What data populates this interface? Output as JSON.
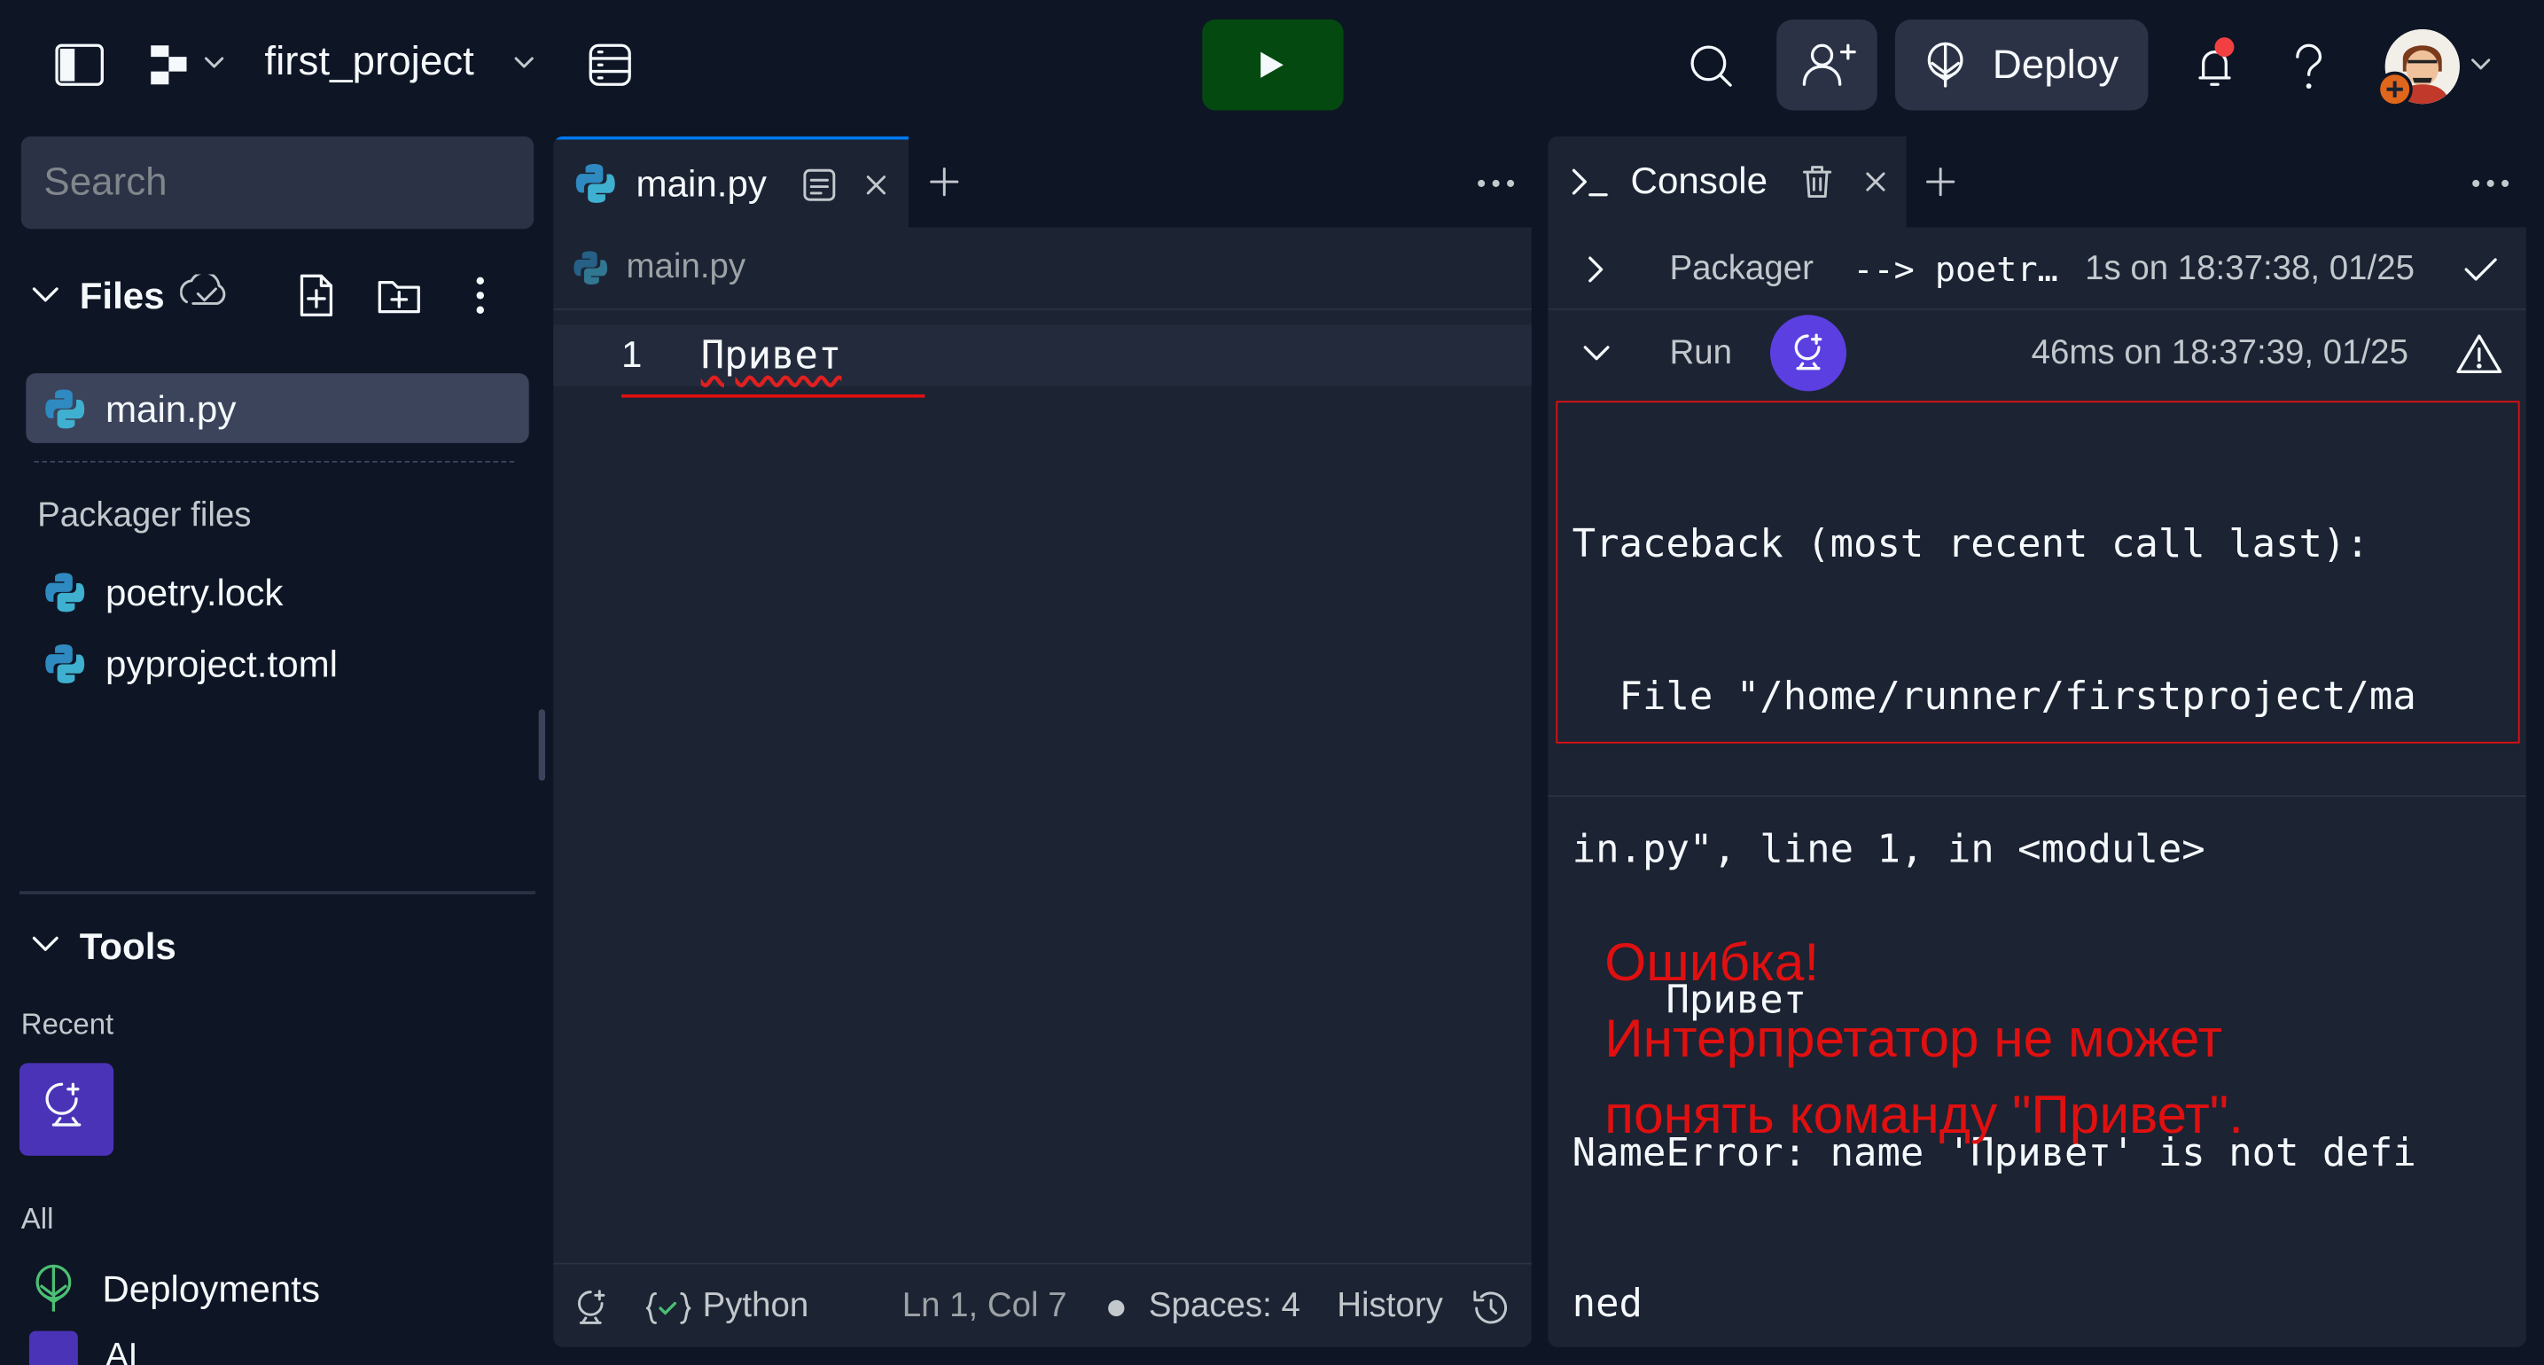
{
  "header": {
    "project_name": "first_project",
    "deploy_label": "Deploy",
    "icons": [
      "sidebar-toggle-icon",
      "logo-icon",
      "chevron-down-icon",
      "storage-icon",
      "run-play-icon",
      "search-icon",
      "invite-user-icon",
      "deploy-icon",
      "bell-icon",
      "help-icon",
      "avatar"
    ]
  },
  "sidebar": {
    "search_placeholder": "Search",
    "files_label": "Files",
    "files": [
      {
        "name": "main.py",
        "icon": "python-icon",
        "selected": true
      }
    ],
    "packager_label": "Packager files",
    "packager_files": [
      {
        "name": "poetry.lock",
        "icon": "python-icon"
      },
      {
        "name": "pyproject.toml",
        "icon": "python-icon"
      }
    ],
    "tools_label": "Tools",
    "recent_label": "Recent",
    "all_label": "All",
    "all_items": [
      {
        "name": "Deployments",
        "icon": "deploy-icon"
      },
      {
        "name": "AI",
        "icon": "ai-icon"
      }
    ]
  },
  "editor": {
    "tab_label": "main.py",
    "breadcrumb": "main.py",
    "lines": [
      {
        "number": "1",
        "code": "Привет"
      }
    ],
    "status": {
      "language": "Python",
      "position": "Ln 1, Col 7",
      "spaces": "Spaces: 4",
      "history": "History"
    }
  },
  "console": {
    "tab_label": "Console",
    "entries": [
      {
        "label": "Packager",
        "detail": "--> poetr…",
        "time": "1s on 18:37:38, 01/25",
        "status": "success"
      },
      {
        "label": "Run",
        "time": "46ms on 18:37:39, 01/25",
        "status": "warning"
      }
    ],
    "traceback": [
      "Traceback (most recent call last):",
      "  File \"/home/runner/firstproject/ma",
      "in.py\", line 1, in <module>",
      "    Привет",
      "NameError: name 'Привет' is not defi",
      "ned"
    ],
    "annotation": [
      "Ошибка!",
      "Интерпретатор не может",
      "понять команду \"Привет\"."
    ]
  },
  "colors": {
    "background": "#0e1525",
    "surface": "#1c2333",
    "run_button": "#044a10",
    "accent_purple": "#5b3fe0",
    "error_red": "#e01010",
    "notification_dot": "#f23f42",
    "python_blue": "#2e8ac0"
  }
}
